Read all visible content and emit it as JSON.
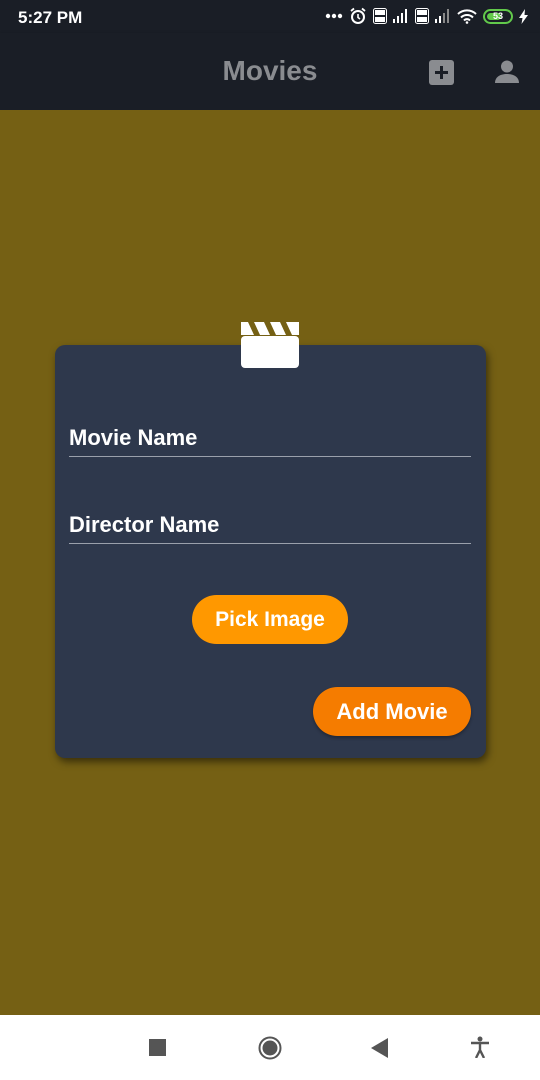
{
  "status_bar": {
    "time": "5:27 PM",
    "battery_level": "53",
    "icons": [
      "more-dots-icon",
      "alarm-icon",
      "volte-icon",
      "signal-icon",
      "volte-icon",
      "signal-icon",
      "wifi-icon",
      "battery-icon",
      "charging-icon"
    ]
  },
  "app_bar": {
    "title": "Movies",
    "actions": [
      "add-box-icon",
      "person-icon"
    ]
  },
  "form": {
    "icon": "clapperboard-icon",
    "movie_name_label": "Movie Name",
    "director_name_label": "Director Name",
    "pick_image_label": "Pick Image",
    "add_movie_label": "Add Movie"
  },
  "colors": {
    "background": "#756014",
    "card": "#2e384c",
    "app_bar": "#1a1e26",
    "pick_button": "#ff9800",
    "add_button": "#f57c00"
  },
  "nav_bar": {
    "buttons": [
      "recents-square-icon",
      "home-circle-icon",
      "back-triangle-icon",
      "accessibility-icon"
    ]
  }
}
